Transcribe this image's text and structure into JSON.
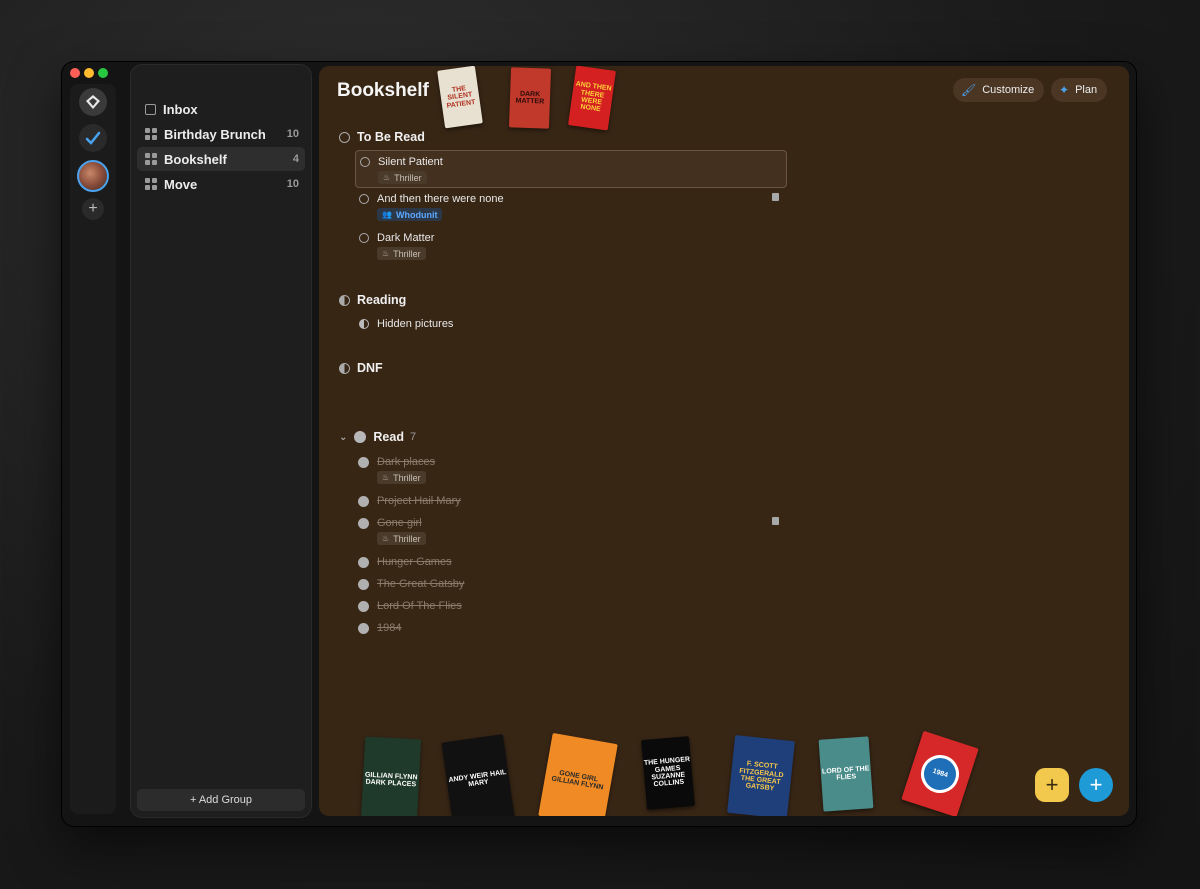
{
  "sidebar": {
    "items": [
      {
        "label": "Inbox",
        "count": ""
      },
      {
        "label": "Birthday Brunch",
        "count": "10"
      },
      {
        "label": "Bookshelf",
        "count": "4"
      },
      {
        "label": "Move",
        "count": "10"
      }
    ],
    "add_group_label": "+ Add Group"
  },
  "main": {
    "title": "Bookshelf",
    "customize_label": "Customize",
    "plan_label": "Plan",
    "header_covers": [
      {
        "text": "THE SILENT PATIENT",
        "color": "#e8e0d0"
      },
      {
        "text": "DARK MATTER",
        "color": "#c0392b"
      },
      {
        "text": "AND THEN THERE WERE NONE",
        "color": "#d42020"
      }
    ],
    "sections": [
      {
        "title": "To Be Read",
        "count": ""
      },
      {
        "title": "Reading",
        "count": ""
      },
      {
        "title": "DNF",
        "count": ""
      },
      {
        "title": "Read",
        "count": "7"
      }
    ],
    "tasks_tbr": [
      {
        "title": "Silent Patient",
        "tag": "Thriller"
      },
      {
        "title": "And then there were none",
        "tag": "Whodunit"
      },
      {
        "title": "Dark Matter",
        "tag": "Thriller"
      }
    ],
    "tasks_reading": [
      {
        "title": "Hidden pictures"
      }
    ],
    "tasks_read": [
      {
        "title": "Dark places",
        "tag": "Thriller"
      },
      {
        "title": "Project Hail Mary"
      },
      {
        "title": "Gone girl",
        "tag": "Thriller"
      },
      {
        "title": "Hunger Games"
      },
      {
        "title": "The Great Gatsby"
      },
      {
        "title": "Lord Of The Flies"
      },
      {
        "title": "1984"
      }
    ],
    "bottom_covers": [
      {
        "text": "GILLIAN FLYNN DARK PLACES",
        "color": "#1f3a2a"
      },
      {
        "text": "ANDY WEIR HAIL MARY",
        "color": "#111111"
      },
      {
        "text": "GONE GIRL GILLIAN FLYNN",
        "color": "#f08a24"
      },
      {
        "text": "THE HUNGER GAMES SUZANNE COLLINS",
        "color": "#0a0a0a"
      },
      {
        "text": "F. SCOTT FITZGERALD THE GREAT GATSBY",
        "color": "#1f3f7a"
      },
      {
        "text": "LORD OF THE FLIES",
        "color": "#4a8c8a"
      },
      {
        "text": "1984",
        "color": "#d62828"
      }
    ]
  },
  "colors": {
    "accent": "#4aa3f0",
    "main_bg": "#382615",
    "fab_yellow": "#f2c94c",
    "fab_blue": "#1e9bd7"
  },
  "icons": {
    "rail": [
      "app-logo-icon",
      "checkmark-icon",
      "avatar",
      "plus-icon"
    ],
    "customize": "brush-icon",
    "plan": "sparkle-icon",
    "tag": "flame-icon",
    "whodunit": "people-icon"
  }
}
